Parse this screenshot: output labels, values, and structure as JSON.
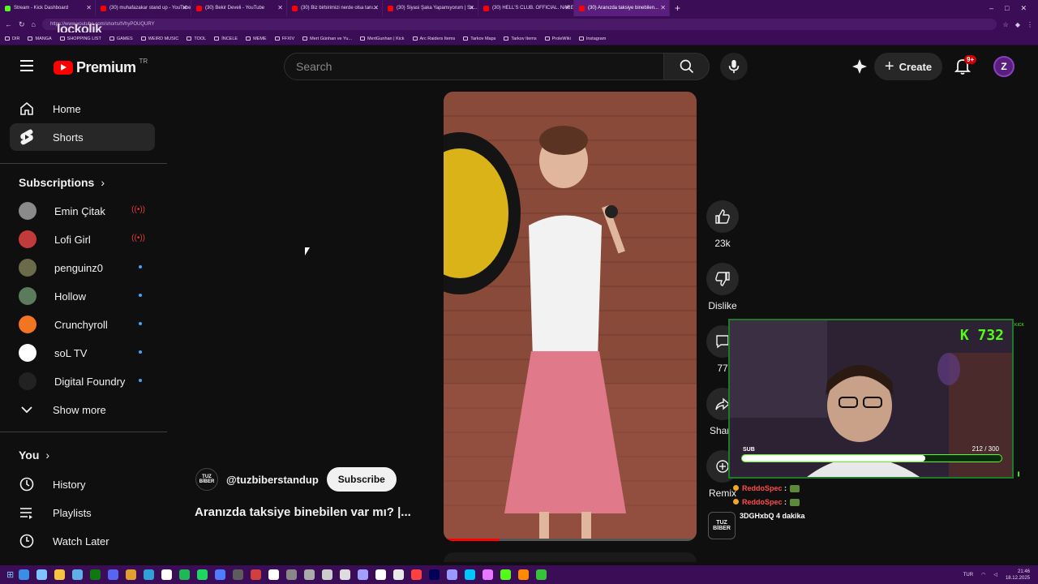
{
  "browser": {
    "tabs": [
      {
        "title": "Stream - Kick Dashboard",
        "color": "#53fc18"
      },
      {
        "title": "(30) muhafazakar stand up - YouTube",
        "color": "#ff0000"
      },
      {
        "title": "(30) Bekir Develi - YouTube",
        "color": "#ff0000"
      },
      {
        "title": "(30) Biz birbirimizi nerde olsa tanı...",
        "color": "#ff0000"
      },
      {
        "title": "(30) Siyasi Şaka Yapamıyorum | Sa...",
        "color": "#ff0000"
      },
      {
        "title": "(30) HELL'S CLUB. OFFICIAL. NARE...",
        "color": "#ff0000"
      },
      {
        "title": "(30) Aranızda taksiye binebilen...",
        "color": "#ff0000"
      }
    ],
    "url": "https://www.youtube.com/shorts/tVhyPOUQURY",
    "overlay_logo": "lockolik",
    "bookmarks": [
      "DIR",
      "MANGA",
      "SHOPPING LIST",
      "GAMES",
      "WEIRD MUSIC",
      "TOOL",
      "İNCELE",
      "MEME",
      "FFXIV",
      "Mert Günhan ve Yu...",
      "MertGunhan | Kick",
      "Arc Raiders Items",
      "Tarkov Maps",
      "Tarkov Items",
      "ProleWiki",
      "Instagram"
    ]
  },
  "yt": {
    "logo_word": "Premium",
    "country": "TR",
    "search_placeholder": "Search",
    "create_label": "Create",
    "notif_badge": "9+",
    "nav": [
      {
        "label": "Home",
        "icon": "home-icon"
      },
      {
        "label": "Shorts",
        "icon": "shorts-icon"
      }
    ],
    "subscriptions_heading": "Subscriptions",
    "subscriptions": [
      {
        "name": "Emin Çitak",
        "status": "live",
        "color": "#8a8a8a"
      },
      {
        "name": "Lofi Girl",
        "status": "live",
        "color": "#c23b3b"
      },
      {
        "name": "penguinz0",
        "status": "new",
        "color": "#6b6b4a"
      },
      {
        "name": "Hollow",
        "status": "new",
        "color": "#5c7a5c"
      },
      {
        "name": "Crunchyroll",
        "status": "new",
        "color": "#f47521"
      },
      {
        "name": "soL TV",
        "status": "new",
        "color": "#ffffff"
      },
      {
        "name": "Digital Foundry",
        "status": "new",
        "color": "#222222"
      }
    ],
    "show_more": "Show more",
    "you_heading": "You",
    "you_items": [
      {
        "label": "History",
        "icon": "history-icon"
      },
      {
        "label": "Playlists",
        "icon": "playlists-icon"
      },
      {
        "label": "Watch Later",
        "icon": "watch-later-icon"
      }
    ],
    "short": {
      "channel": "@tuzbiberstandup",
      "channel_avatar_text": "TUZ BİBER",
      "subscribe": "Subscribe",
      "title": "Aranızda taksiye binebilen var mı? |...",
      "likes": "23k",
      "dislike": "Dislike",
      "comments": "77",
      "share": "Share",
      "remix": "Remix",
      "progress": 0.22
    }
  },
  "stream": {
    "hud": "K 732",
    "sub_label": "SUB",
    "sub_current": 212,
    "sub_goal": 300,
    "sub_text": "212 / 300",
    "chat": [
      {
        "user": "ReddoSpec",
        "text": ":"
      },
      {
        "user": "ReddoSpec",
        "text": ":"
      },
      {
        "user": "",
        "text": "3DGHxbQ 4 dakika"
      }
    ]
  },
  "taskbar": {
    "lang": "TUR",
    "time": "21:46",
    "date": "18.12.2025"
  }
}
